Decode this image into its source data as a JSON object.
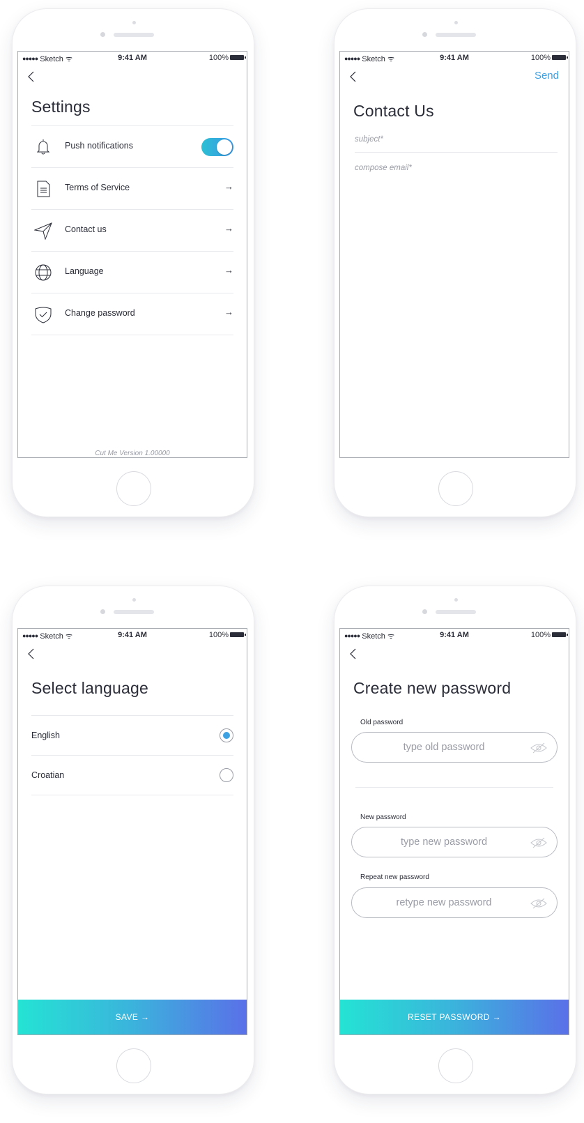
{
  "status_bar": {
    "carrier": "Sketch",
    "time": "9:41 AM",
    "battery": "100%"
  },
  "settings": {
    "title": "Settings",
    "items": [
      {
        "label": "Push notifications",
        "icon": "bell-icon",
        "control": "toggle",
        "enabled": true
      },
      {
        "label": "Terms of Service",
        "icon": "document-icon",
        "control": "arrow"
      },
      {
        "label": "Contact us",
        "icon": "paper-plane-icon",
        "control": "arrow"
      },
      {
        "label": "Language",
        "icon": "globe-icon",
        "control": "arrow"
      },
      {
        "label": "Change password",
        "icon": "shield-icon",
        "control": "arrow"
      }
    ],
    "arrow": "→",
    "version": "Cut Me Version 1.00000"
  },
  "contact": {
    "title": "Contact Us",
    "send_label": "Send",
    "subject_placeholder": "subject*",
    "body_placeholder": "compose email*"
  },
  "language": {
    "title": "Select language",
    "options": [
      {
        "label": "English",
        "selected": true
      },
      {
        "label": "Croatian",
        "selected": false
      }
    ],
    "save_label": "SAVE →"
  },
  "password": {
    "title": "Create new password",
    "old_label": "Old password",
    "old_placeholder": "type old password",
    "new_label": "New password",
    "new_placeholder": "type new password",
    "repeat_label": "Repeat new password",
    "repeat_placeholder": "retype new password",
    "reset_label": "RESET PASSWORD →"
  },
  "colors": {
    "accent": "#3ea1e2",
    "gradient_start": "#24e3d4",
    "gradient_end": "#5a70e8",
    "text": "#2b2d38",
    "muted": "#9a9ca6"
  }
}
